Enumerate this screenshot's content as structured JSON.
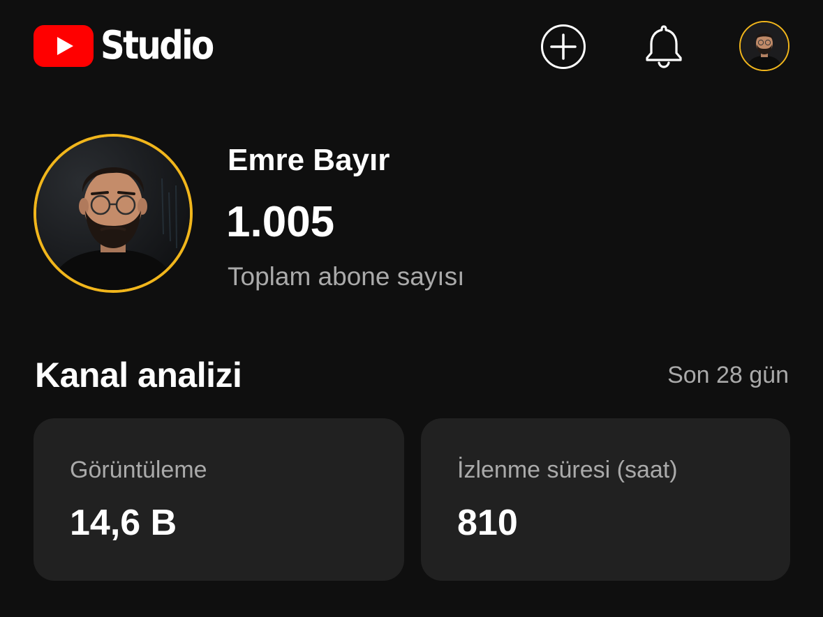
{
  "header": {
    "logo_text": "Studio",
    "icons": {
      "logo": "youtube-play-icon",
      "create": "plus-circle-icon",
      "notifications": "bell-icon",
      "account": "account-avatar"
    }
  },
  "channel": {
    "name": "Emre Bayır",
    "subscriber_count": "1.005",
    "subscriber_label": "Toplam abone sayısı"
  },
  "analytics": {
    "title": "Kanal analizi",
    "period": "Son 28 gün",
    "cards": [
      {
        "label": "Görüntüleme",
        "value": "14,6 B"
      },
      {
        "label": "İzlenme süresi (saat)",
        "value": "810"
      }
    ]
  },
  "colors": {
    "background": "#0f0f0f",
    "card": "#212121",
    "brand_red": "#ff0000",
    "avatar_ring": "#f1b61c",
    "secondary_text": "#aaaaaa"
  }
}
